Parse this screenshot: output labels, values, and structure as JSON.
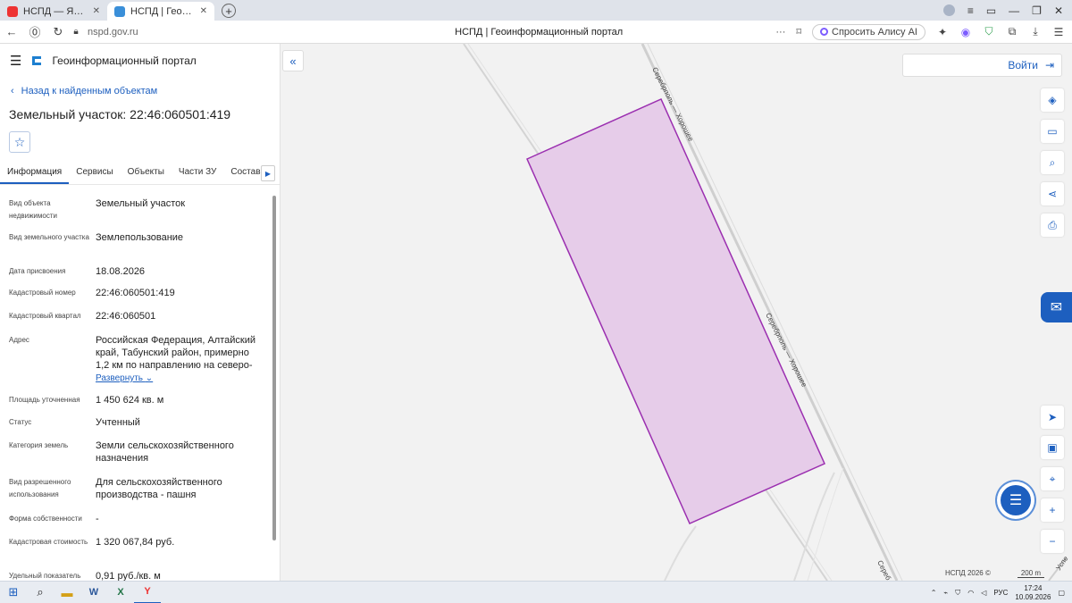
{
  "browser": {
    "tabs": [
      {
        "title": "НСПД — Яндекс: нашлось",
        "favicon": "yandex-icon",
        "active": false
      },
      {
        "title": "НСПД | Геоинформацио",
        "favicon": "nspd-icon",
        "active": true
      }
    ],
    "url": "nspd.gov.ru",
    "page_title": "НСПД | Геоинформационный портал",
    "alice_label": "Спросить Алису AI"
  },
  "panel": {
    "brand": "Геоинформационный портал",
    "back_link": "Назад к найденным объектам",
    "title": "Земельный участок: 22:46:060501:419",
    "tabs": [
      "Информация",
      "Сервисы",
      "Объекты",
      "Части ЗУ",
      "Состав"
    ],
    "fields": [
      {
        "key": "Вид объекта недвижимости",
        "value": "Земельный участок"
      },
      {
        "key": "Вид земельного участка",
        "value": "Землепользование"
      },
      {
        "key": "Дата присвоения",
        "value": "18.08.2026"
      },
      {
        "key": "Кадастровый номер",
        "value": "22:46:060501:419"
      },
      {
        "key": "Кадастровый квартал",
        "value": "22:46:060501"
      },
      {
        "key": "Адрес",
        "value": "Российская Федерация, Алтайский край, Табунский район, примерно 1,2 км по направлению на северо-",
        "expand": "Развернуть"
      },
      {
        "key": "Площадь уточненная",
        "value": "1 450 624 кв. м"
      },
      {
        "key": "Статус",
        "value": "Учтенный"
      },
      {
        "key": "Категория земель",
        "value": "Земли сельскохозяйственного назначения"
      },
      {
        "key": "Вид разрешенного использования",
        "value": "Для сельскохозяйственного производства - пашня"
      },
      {
        "key": "Форма собственности",
        "value": "-"
      },
      {
        "key": "Кадастровая стоимость",
        "value": "1 320 067,84 руб."
      },
      {
        "key": "Удельный показатель",
        "value": "0,91 руб./кв. м"
      }
    ]
  },
  "map": {
    "login_label": "Войти",
    "road_label_1": "Серебрполь — Хорошее",
    "road_label_2": "Серебрполь — Хорошее",
    "road_label_3": "Сереб",
    "road_label_4": "Успе",
    "attribution": "НСПД 2026 ©",
    "scale_label": "200 m",
    "parcel_fill": "#e6cce9",
    "parcel_stroke": "#9b2fb0"
  },
  "taskbar": {
    "lang": "РУС",
    "time": "17:24",
    "date": "10.09.2026"
  }
}
